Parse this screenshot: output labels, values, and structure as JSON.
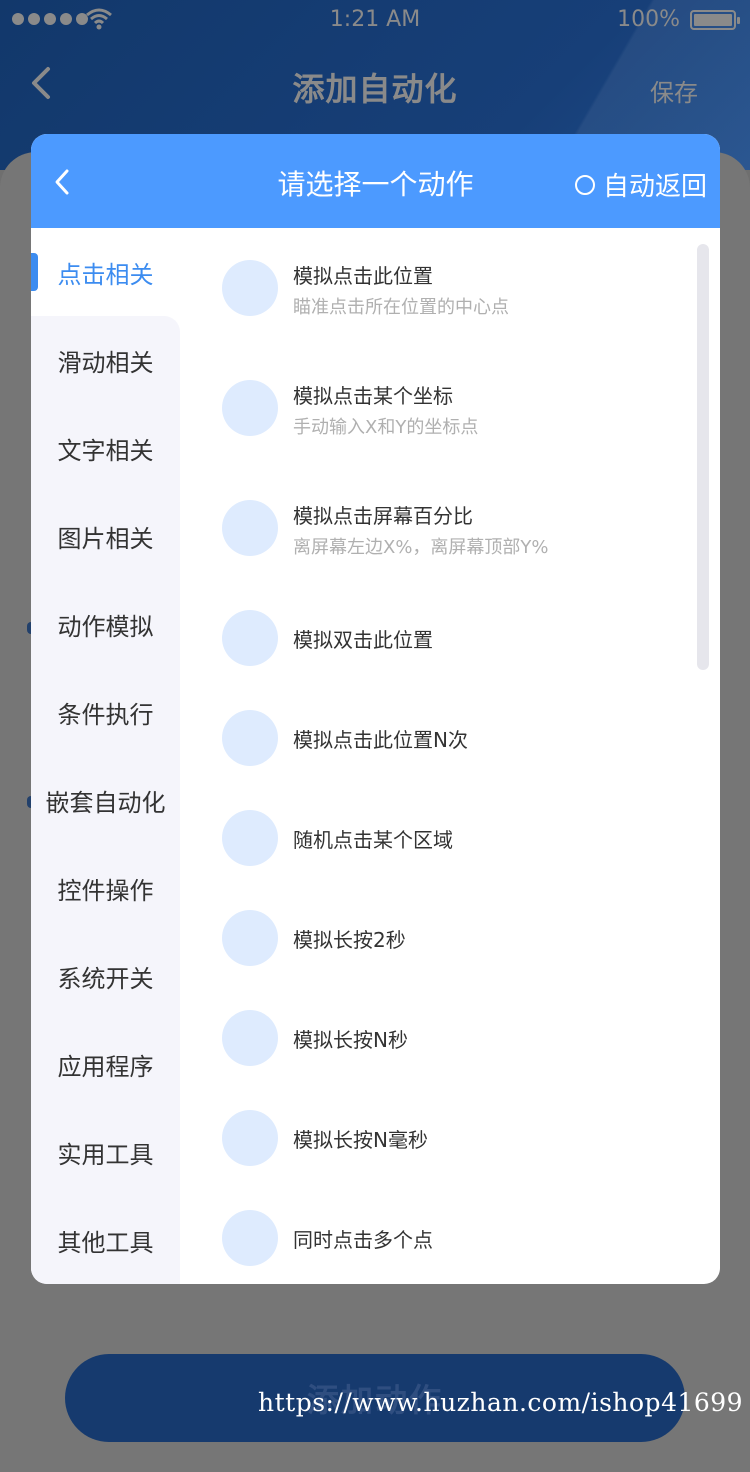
{
  "status_bar": {
    "time": "1:21 AM",
    "battery": "100%"
  },
  "nav": {
    "title": "添加自动化",
    "save": "保存"
  },
  "modal": {
    "title": "请选择一个动作",
    "auto_return": "自动返回",
    "categories": [
      {
        "label": "点击相关",
        "active": true
      },
      {
        "label": "滑动相关"
      },
      {
        "label": "文字相关"
      },
      {
        "label": "图片相关"
      },
      {
        "label": "动作模拟"
      },
      {
        "label": "条件执行"
      },
      {
        "label": "嵌套自动化"
      },
      {
        "label": "控件操作"
      },
      {
        "label": "系统开关"
      },
      {
        "label": "应用程序"
      },
      {
        "label": "实用工具"
      },
      {
        "label": "其他工具"
      }
    ],
    "actions": [
      {
        "title": "模拟点击此位置",
        "subtitle": "瞄准点击所在位置的中心点"
      },
      {
        "title": "模拟点击某个坐标",
        "subtitle": "手动输入X和Y的坐标点"
      },
      {
        "title": "模拟点击屏幕百分比",
        "subtitle": "离屏幕左边X%，离屏幕顶部Y%"
      },
      {
        "title": "模拟双击此位置"
      },
      {
        "title": "模拟点击此位置N次"
      },
      {
        "title": "随机点击某个区域"
      },
      {
        "title": "模拟长按2秒"
      },
      {
        "title": "模拟长按N秒"
      },
      {
        "title": "模拟长按N毫秒"
      },
      {
        "title": "同时点击多个点"
      }
    ]
  },
  "bottom_button": "添加动作",
  "watermark": "https://www.huzhan.com/ishop41699",
  "colors": {
    "accent": "#4c9aff",
    "active_text": "#3c8cf0",
    "icon_bg": "#deebfe"
  }
}
